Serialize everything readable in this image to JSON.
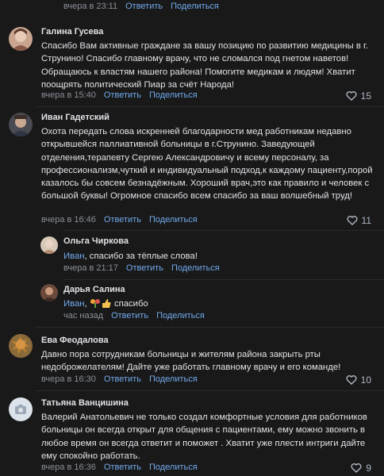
{
  "top": {
    "time": "вчера в 23:11",
    "reply": "Ответить",
    "share": "Поделиться"
  },
  "comments": [
    {
      "author": "Галина Гусева",
      "text": "Спасибо Вам активные граждане за вашу позицию по развитию медицины в г. Струнино! Спасибо главному врачу, что не сломался под гнетом наветов! Обращаюсь к властям нашего района! Помогите медикам и людям! Хватит поощрять политический Пиар за счёт Народа!",
      "time": "вчера в 15:40",
      "reply": "Ответить",
      "share": "Поделиться",
      "likes": "15"
    },
    {
      "author": "Иван Гадетский",
      "text": "Охота передать слова искренней благодарности мед работникам недавно открывшейся паллиативной больницы в г.Струнино. Заведующей отделения,терапевту Сергею Александровичу и всему персоналу, за профессионализм,чуткий и индивидуальный подход,к каждому пациенту,порой казалось бы совсем безнадёжным. Хороший врач,это как правило и человек с большой буквы! Огромное спасибо всем спасибо за ваш волшебный труд!",
      "time": "вчера в 16:46",
      "reply": "Ответить",
      "share": "Поделиться",
      "likes": "11"
    },
    {
      "author": "Ольга Чиркова",
      "mention": "Иван",
      "text": ", спасибо за тёплые слова!",
      "time": "вчера в 21:17",
      "reply": "Ответить",
      "share": "Поделиться"
    },
    {
      "author": "Дарья Салина",
      "mention": "Иван",
      "text": "спасибо",
      "time": "час назад",
      "reply": "Ответить",
      "share": "Поделиться"
    },
    {
      "author": "Ева Феодалова",
      "text": "Давно пора сотрудникам больницы и жителям района закрыть рты недоброжелателям! Дайте уже работать главному врачу и его команде!",
      "time": "вчера в 16:30",
      "reply": "Ответить",
      "share": "Поделиться",
      "likes": "10"
    },
    {
      "author": "Татьяна Ванцишина",
      "text": "Валерий Анатольевич не только создал комфортные условия для работников больницы он всегда открыт для общения с пациентами, ему можно звонить в любое время он всегда ответит и поможет . Хватит уже плести интриги дайте ему спокойно работать.",
      "time": "вчера в 16:36",
      "reply": "Ответить",
      "share": "Поделиться",
      "likes": "9"
    }
  ],
  "colors": {
    "background": "#19191a",
    "link": "#71aaeb",
    "meta": "#8a8f96",
    "text": "#e1e3e6"
  }
}
